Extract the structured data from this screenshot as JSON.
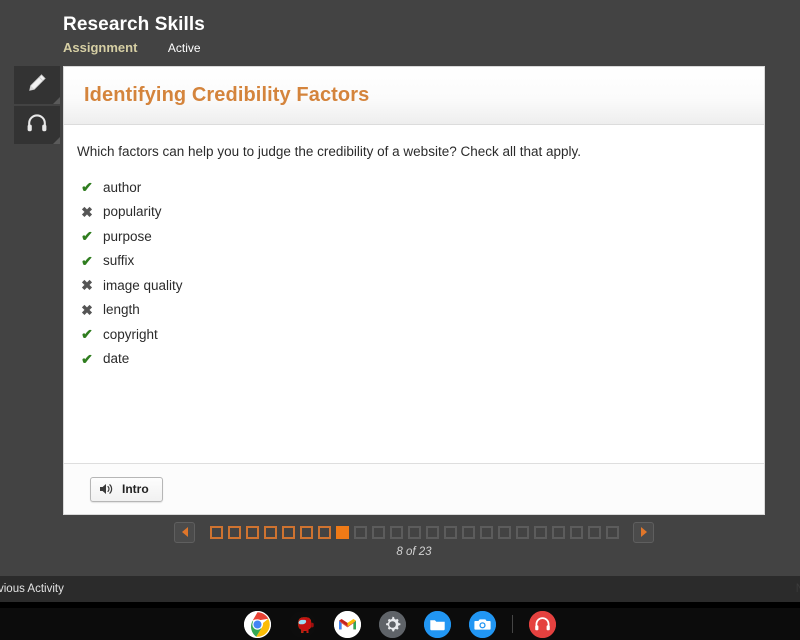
{
  "header": {
    "course_title": "Research Skills",
    "assignment_label": "Assignment",
    "status_label": "Active"
  },
  "tool_rail": {
    "items": [
      {
        "icon": "pencil-icon",
        "name": "marker-tool"
      },
      {
        "icon": "headphones-icon",
        "name": "audio-tool"
      }
    ]
  },
  "card": {
    "title": "Identifying Credibility Factors",
    "question": "Which factors can help you to judge the credibility of a website? Check all that apply.",
    "factors": [
      {
        "label": "author",
        "mark": "check",
        "glyph": "✔"
      },
      {
        "label": "popularity",
        "mark": "cross",
        "glyph": "✖"
      },
      {
        "label": "purpose",
        "mark": "check",
        "glyph": "✔"
      },
      {
        "label": "suffix",
        "mark": "check",
        "glyph": "✔"
      },
      {
        "label": "image quality",
        "mark": "cross",
        "glyph": "✖"
      },
      {
        "label": "length",
        "mark": "cross",
        "glyph": "✖"
      },
      {
        "label": "copyright",
        "mark": "check",
        "glyph": "✔"
      },
      {
        "label": "date",
        "mark": "check",
        "glyph": "✔"
      }
    ],
    "footer": {
      "audio_button_label": "Intro",
      "audio_button_icon": "speaker-icon"
    }
  },
  "pager": {
    "prev_icon": "triangle-left-icon",
    "next_icon": "triangle-right-icon",
    "total": 23,
    "current": 8,
    "count_label": "8 of 23",
    "states": [
      "visited",
      "visited",
      "visited",
      "visited",
      "visited",
      "visited",
      "visited",
      "current",
      "upcoming",
      "upcoming",
      "upcoming",
      "upcoming",
      "upcoming",
      "upcoming",
      "upcoming",
      "upcoming",
      "upcoming",
      "upcoming",
      "upcoming",
      "upcoming",
      "upcoming",
      "upcoming",
      "upcoming"
    ]
  },
  "activity_bar": {
    "previous_label": "vious Activity",
    "next_label": "N"
  },
  "shelf": {
    "icons": [
      {
        "name": "chrome-icon",
        "label": "Chrome"
      },
      {
        "name": "among-us-icon",
        "label": "Among Us"
      },
      {
        "name": "gmail-icon",
        "label": "Gmail"
      },
      {
        "name": "settings-icon",
        "label": "Settings"
      },
      {
        "name": "files-icon",
        "label": "Files"
      },
      {
        "name": "camera-icon",
        "label": "Camera"
      },
      {
        "name": "headset-app-icon",
        "label": "Audio"
      }
    ]
  },
  "colors": {
    "accent_orange": "#ef7a17",
    "title_orange": "#d4843c",
    "assignment_tan": "#d6cfa4",
    "correct_green": "#2f7d1f",
    "wrong_gray": "#555555",
    "chrome_dark": "#434343"
  }
}
